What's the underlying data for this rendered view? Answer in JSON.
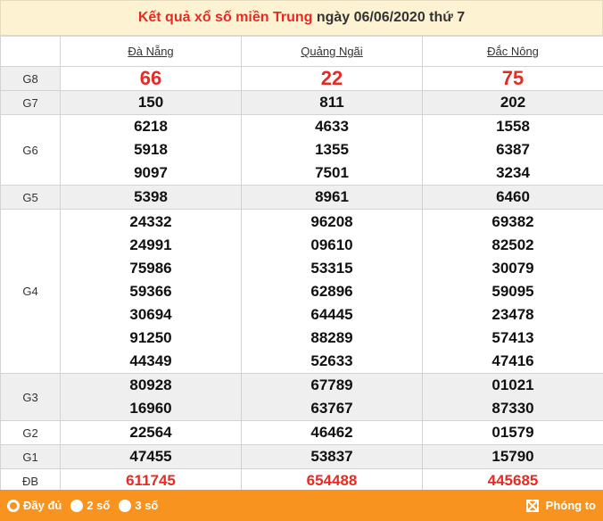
{
  "header": {
    "title_prefix": "Kết quả xổ số miền Trung",
    "title_date": "ngày 06/06/2020 thứ 7"
  },
  "provinces": [
    "Đà Nẵng",
    "Quảng Ngãi",
    "Đắc Nông"
  ],
  "prizes": {
    "g8": {
      "label": "G8",
      "values": [
        "66",
        "22",
        "75"
      ]
    },
    "g7": {
      "label": "G7",
      "values": [
        "150",
        "811",
        "202"
      ]
    },
    "g6": {
      "label": "G6",
      "values": [
        [
          "6218",
          "5918",
          "9097"
        ],
        [
          "4633",
          "1355",
          "7501"
        ],
        [
          "1558",
          "6387",
          "3234"
        ]
      ]
    },
    "g5": {
      "label": "G5",
      "values": [
        "5398",
        "8961",
        "6460"
      ]
    },
    "g4": {
      "label": "G4",
      "values": [
        [
          "24332",
          "24991",
          "75986",
          "59366",
          "30694",
          "91250",
          "44349"
        ],
        [
          "96208",
          "09610",
          "53315",
          "62896",
          "64445",
          "88289",
          "52633"
        ],
        [
          "69382",
          "82502",
          "30079",
          "59095",
          "23478",
          "57413",
          "47416"
        ]
      ]
    },
    "g3": {
      "label": "G3",
      "values": [
        [
          "80928",
          "16960"
        ],
        [
          "67789",
          "63767"
        ],
        [
          "01021",
          "87330"
        ]
      ]
    },
    "g2": {
      "label": "G2",
      "values": [
        "22564",
        "46462",
        "01579"
      ]
    },
    "g1": {
      "label": "G1",
      "values": [
        "47455",
        "53837",
        "15790"
      ]
    },
    "db": {
      "label": "ĐB",
      "values": [
        "611745",
        "654488",
        "445685"
      ]
    }
  },
  "footer": {
    "options": [
      "Đầy đủ",
      "2 số",
      "3 số"
    ],
    "zoom_label": "Phóng to"
  },
  "colors": {
    "accent_red": "#e52b24",
    "bar_orange": "#f7931e",
    "header_bg": "#fdf3d2"
  },
  "icons": {
    "zoom": "expand-arrows-icon",
    "radio": "radio-icon"
  }
}
